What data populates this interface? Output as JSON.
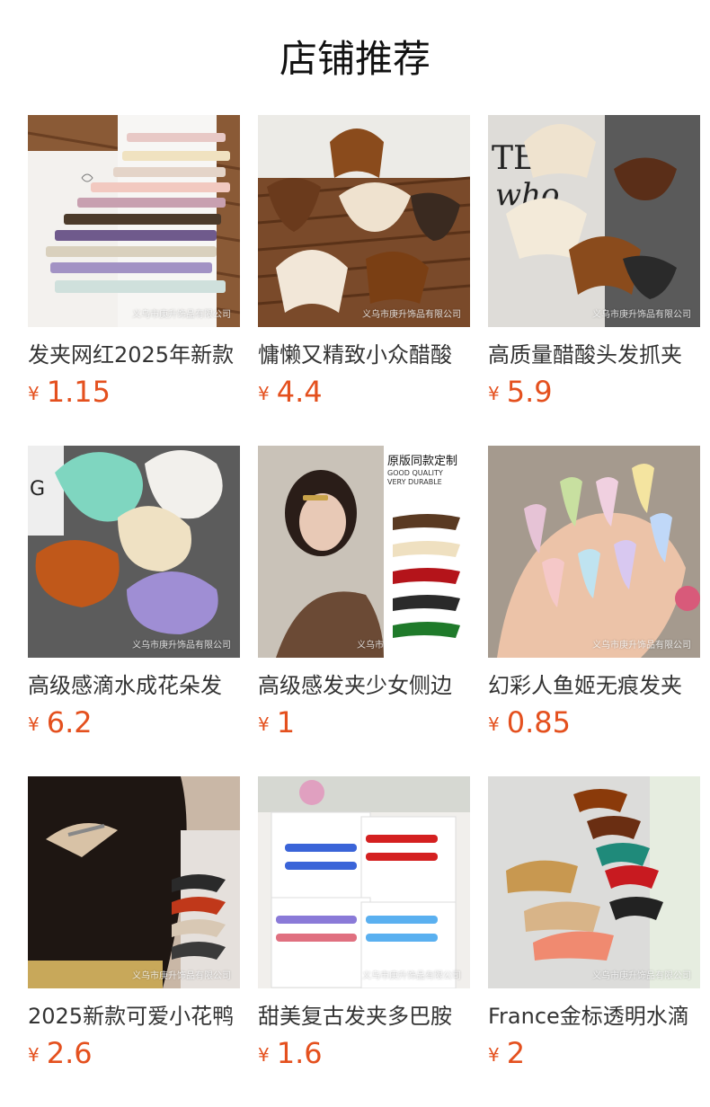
{
  "page": {
    "title": "店铺推荐"
  },
  "colors": {
    "price": "#e4501e",
    "text": "#333333",
    "title": "#111111"
  },
  "products": [
    {
      "name": "发夹网红2025年新款",
      "currency": "¥",
      "price": "1.15",
      "watermark": "义乌市庚升饰品有限公司"
    },
    {
      "name": "慵懒又精致小众醋酸",
      "currency": "¥",
      "price": "4.4",
      "watermark": "义乌市庚升饰品有限公司"
    },
    {
      "name": "高质量醋酸头发抓夹",
      "currency": "¥",
      "price": "5.9",
      "watermark": "义乌市庚升饰品有限公司"
    },
    {
      "name": "高级感滴水成花朵发",
      "currency": "¥",
      "price": "6.2",
      "watermark": "义乌市庚升饰品有限公司"
    },
    {
      "name": "高级感发夹少女侧边",
      "currency": "¥",
      "price": "1",
      "watermark": "义乌市",
      "poster_title": "原版同款定制",
      "poster_sub1": "GOOD QUALITY",
      "poster_sub2": "VERY DURABLE"
    },
    {
      "name": "幻彩人鱼姬无痕发夹",
      "currency": "¥",
      "price": "0.85",
      "watermark": "义乌市庚升饰品有限公司"
    },
    {
      "name": "2025新款可爱小花鸭",
      "currency": "¥",
      "price": "2.6",
      "watermark": "义乌市庚升饰品有限公司"
    },
    {
      "name": "甜美复古发夹多巴胺",
      "currency": "¥",
      "price": "1.6",
      "watermark": "义乌市庚升饰品有限公司"
    },
    {
      "name": "France金标透明水滴",
      "currency": "¥",
      "price": "2",
      "watermark": "义乌市庚升饰品有限公司"
    }
  ]
}
